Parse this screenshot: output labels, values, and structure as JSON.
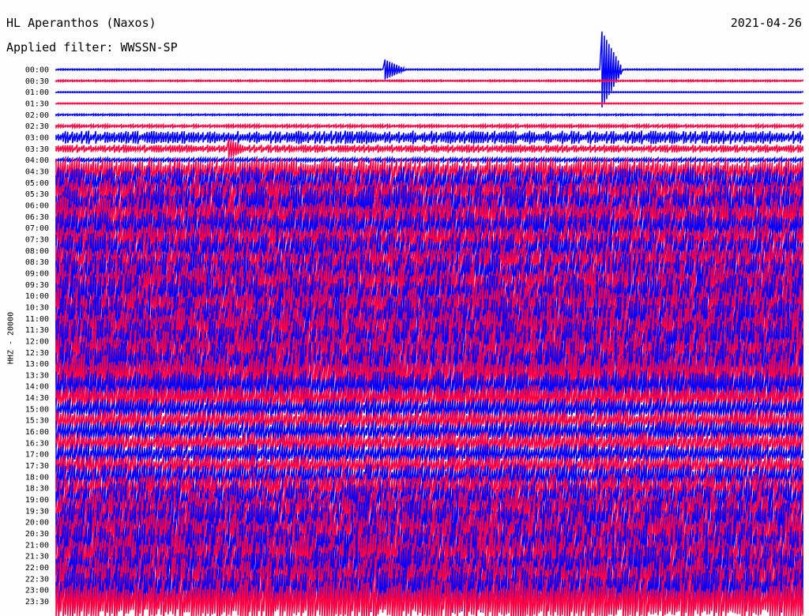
{
  "header": {
    "station": "HL Aperanthos (Naxos)",
    "date": "2021-04-26",
    "filter": "Applied filter: WWSSN-SP"
  },
  "channel_label": "HHZ - 20000",
  "colors": {
    "even_trace": "#0000ff",
    "odd_trace": "#ff0040",
    "background": "#fefefe"
  },
  "chart_data": {
    "type": "line",
    "title": "HL Aperanthos (Naxos)",
    "subtitle": "Applied filter: WWSSN-SP",
    "ylabel": "HHZ - 20000",
    "xlabel": "",
    "grid": false,
    "legend": "none",
    "trace_colors": [
      "#0000ff",
      "#ff0040"
    ],
    "tick_labels": [
      "00:00",
      "00:30",
      "01:00",
      "01:30",
      "02:00",
      "02:30",
      "03:00",
      "03:30",
      "04:00",
      "04:30",
      "05:00",
      "05:30",
      "06:00",
      "06:30",
      "07:00",
      "07:30",
      "08:00",
      "08:30",
      "09:00",
      "09:30",
      "10:00",
      "10:30",
      "11:00",
      "11:30",
      "12:00",
      "12:30",
      "13:00",
      "13:30",
      "14:00",
      "14:30",
      "15:00",
      "15:30",
      "16:00",
      "16:30",
      "17:00",
      "17:30",
      "18:00",
      "18:30",
      "19:00",
      "19:30",
      "20:00",
      "20:30",
      "21:00",
      "21:30",
      "22:00",
      "22:30",
      "23:00",
      "23:30"
    ],
    "amplitude": [
      0.06,
      0.08,
      0.03,
      0.03,
      0.08,
      0.15,
      0.6,
      0.35,
      0.2,
      1.2,
      1.4,
      1.6,
      1.8,
      1.8,
      1.6,
      1.5,
      1.6,
      1.7,
      1.8,
      1.9,
      2.0,
      2.0,
      2.0,
      2.0,
      2.0,
      2.0,
      2.0,
      2.0,
      1.5,
      1.2,
      1.0,
      1.0,
      1.0,
      1.0,
      1.0,
      1.0,
      1.2,
      1.4,
      1.6,
      1.8,
      2.0,
      2.0,
      2.0,
      2.0,
      2.0,
      2.0,
      2.0,
      2.0
    ],
    "events": [
      {
        "trace": "00:00",
        "position": 0.44,
        "amplitude": 0.9
      },
      {
        "trace": "00:00",
        "position": 0.73,
        "amplitude": 3.5
      },
      {
        "trace": "03:30",
        "position": 0.23,
        "amplitude": 0.9
      }
    ]
  }
}
